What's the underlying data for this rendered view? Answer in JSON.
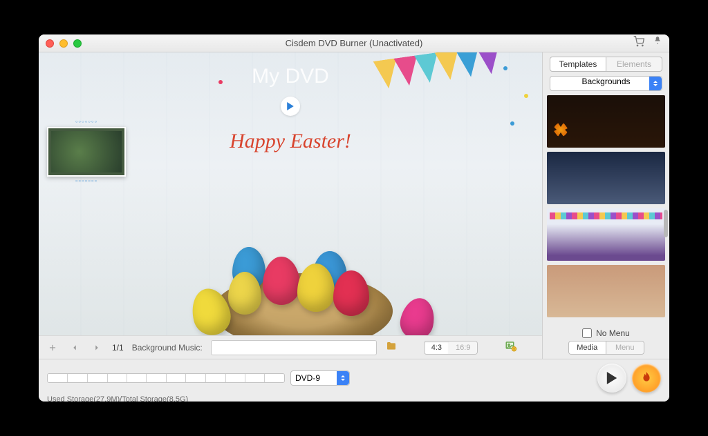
{
  "window": {
    "title": "Cisdem DVD Burner (Unactivated)"
  },
  "preview": {
    "disc_label": "My DVD",
    "headline": "Happy Easter!"
  },
  "midbar": {
    "page_indicator": "1/1",
    "bg_music_label": "Background Music:",
    "ratio_43": "4:3",
    "ratio_169": "16:9"
  },
  "right": {
    "tab_templates": "Templates",
    "tab_elements": "Elements",
    "selector": "Backgrounds",
    "nomenu_label": "No Menu",
    "mm_media": "Media",
    "mm_menu": "Menu"
  },
  "bottom": {
    "dvd_type": "DVD-9",
    "storage_text": "Used Storage(27.9M)/Total Storage(8.5G)"
  }
}
